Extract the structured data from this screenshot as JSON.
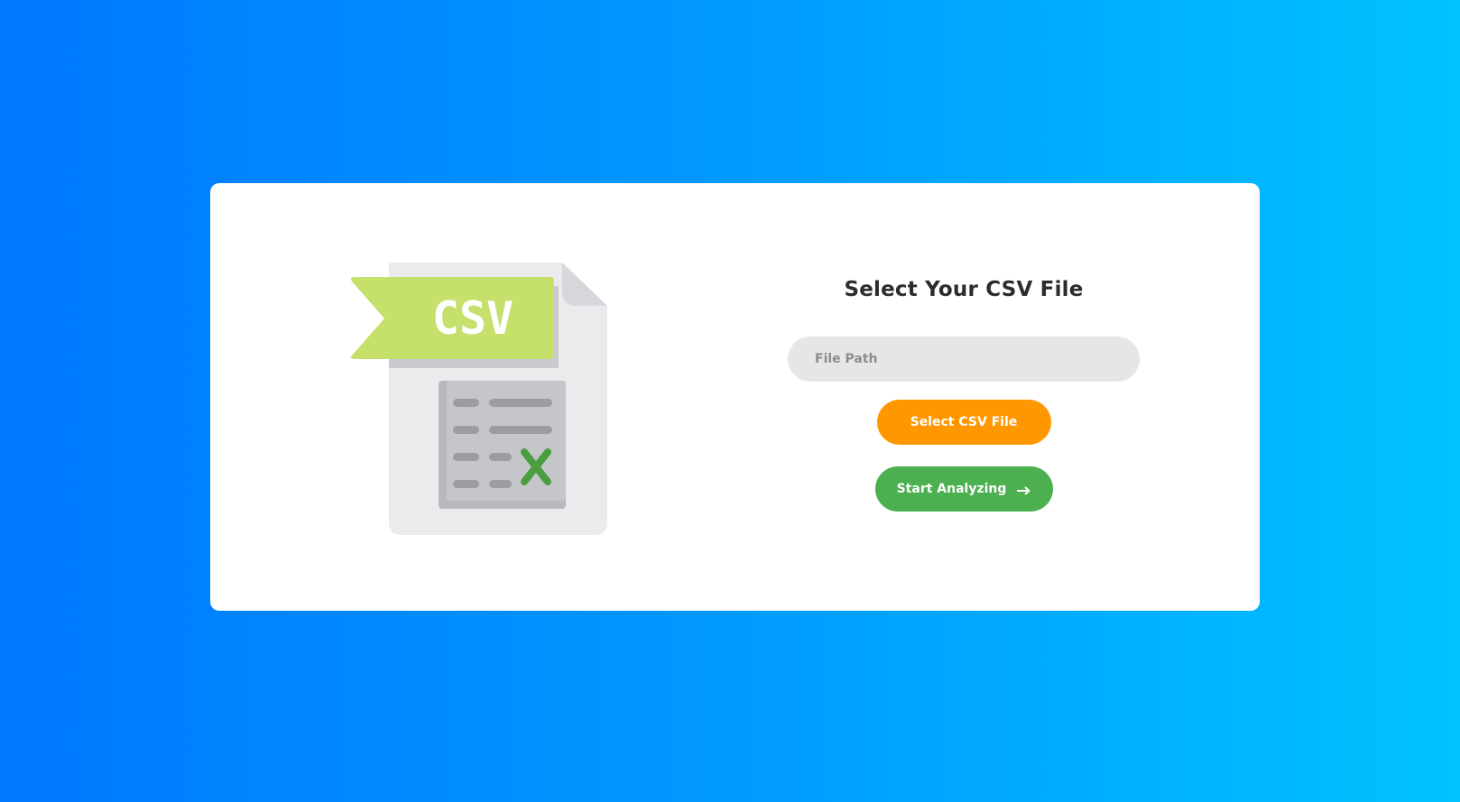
{
  "form": {
    "title": "Select Your CSV File",
    "path_placeholder": "File Path",
    "path_value": "",
    "select_button_label": "Select CSV File",
    "analyze_button_label": "Start Analyzing"
  },
  "illustration": {
    "label": "CSV"
  },
  "icons": {
    "illustration": "csv-file-icon",
    "analyze_button": "arrow-right-icon"
  },
  "colors": {
    "background_start": "#0078ff",
    "background_end": "#00c2ff",
    "select_button": "#ff9800",
    "analyze_button": "#4caf50",
    "ribbon": "#c5e06b",
    "title_text": "#2c2c2c"
  }
}
